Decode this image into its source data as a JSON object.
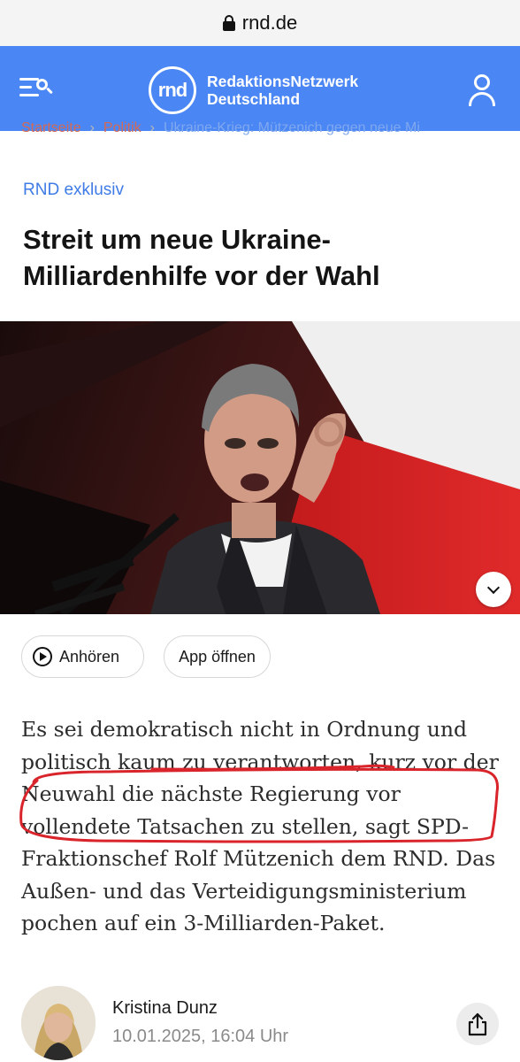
{
  "browser": {
    "url": "rnd.de"
  },
  "header": {
    "logo_mark": "rnd",
    "logo_line1": "RedaktionsNetzwerk",
    "logo_line2": "Deutschland",
    "menu_icon": "menu-search-icon",
    "user_icon": "user-icon",
    "background": "#4b86f5"
  },
  "breadcrumb": {
    "items": [
      "Startseite",
      "Politik",
      "Ukraine-Krieg: Mützenich gegen neue Mi"
    ]
  },
  "article": {
    "kicker": "RND exklusiv",
    "title": "Streit um neue Ukraine-Milliardenhilfe vor der Wahl",
    "expand_icon": "chevron-down-icon",
    "actions": {
      "listen": "Anhören",
      "open_app": "App öffnen"
    },
    "lead": "Es sei demokratisch nicht in Ordnung und politisch kaum zu verantworten, kurz vor der Neuwahl die nächste Regierung vor vollendete Tatsachen zu stellen, sagt SPD-Fraktionschef Rolf Mützenich dem RND. Das Außen- und das Verteidigungsministerium pochen auf ein 3-Milliarden-Paket.",
    "author": {
      "name": "Kristina Dunz",
      "date": "10.01.2025, 16:04 Uhr"
    },
    "share_icon": "share-icon"
  },
  "colors": {
    "accent": "#3f7be6",
    "annotation": "#d8242a"
  }
}
